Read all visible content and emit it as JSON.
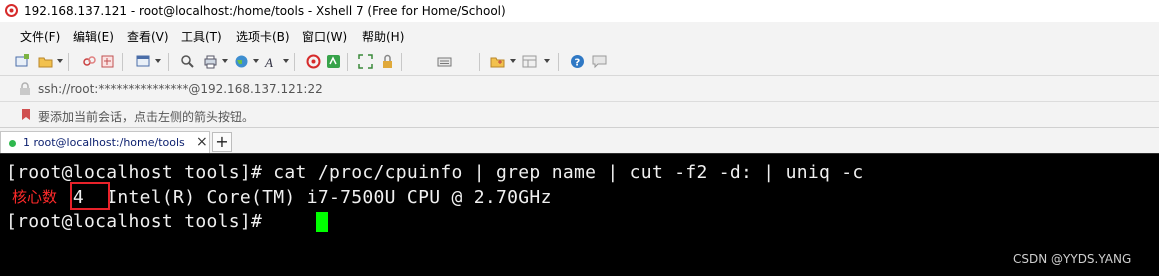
{
  "window": {
    "title": "192.168.137.121 - root@localhost:/home/tools - Xshell 7 (Free for Home/School)"
  },
  "menu": {
    "items": [
      "文件(F)",
      "编辑(E)",
      "查看(V)",
      "工具(T)",
      "选项卡(B)",
      "窗口(W)",
      "帮助(H)"
    ]
  },
  "toolbar": {
    "icons": [
      "new-session-icon",
      "open-folder-icon",
      "disconnect-icon",
      "reconnect-icon",
      "new-tab-icon",
      "find-icon",
      "print-icon",
      "globe-icon",
      "font-icon",
      "xshell-icon",
      "xftp-icon",
      "fullscreen-icon",
      "lock-icon",
      "keyboard-icon",
      "script-icon",
      "layout-icon",
      "help-icon",
      "chat-icon"
    ]
  },
  "address": {
    "text": "ssh://root:***************@192.168.137.121:22"
  },
  "hint": {
    "text": "要添加当前会话，点击左侧的箭头按钮。"
  },
  "tabs": {
    "active_label": "1 root@localhost:/home/tools",
    "close": "×",
    "add": "+"
  },
  "terminal": {
    "lines": [
      "[root@localhost tools]# cat /proc/cpuinfo | grep name | cut -f2 -d: | uniq -c",
      "      4  Intel(R) Core(TM) i7-7500U CPU @ 2.70GHz",
      "[root@localhost tools]# "
    ]
  },
  "annotation": {
    "label": "核心数",
    "color": "#e8222a"
  },
  "watermark": "CSDN @YYDS.YANG"
}
